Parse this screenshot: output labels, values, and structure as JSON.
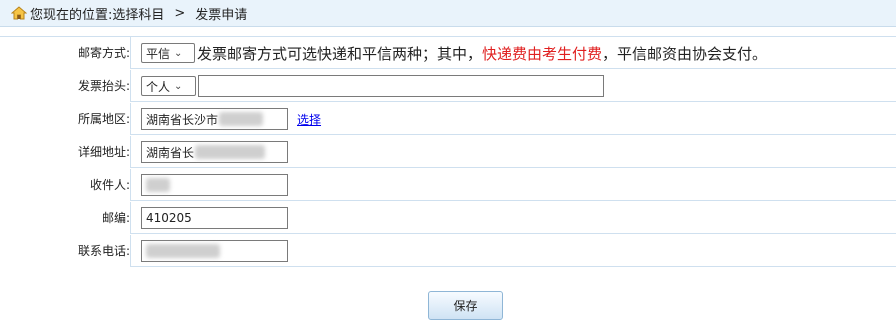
{
  "breadcrumb": {
    "prefix": "您现在的位置:选择科目",
    "separator": ">",
    "current": "发票申请"
  },
  "form": {
    "mail_method": {
      "label": "邮寄方式:",
      "selected": "平信",
      "note_before": "发票邮寄方式可选快递和平信两种；其中，",
      "note_highlight": "快递费由考生付费",
      "note_after": "，平信邮资由协会支付。"
    },
    "invoice_header": {
      "label": "发票抬头:",
      "selected": "个人",
      "value": ""
    },
    "region": {
      "label": "所属地区:",
      "value": "湖南省长沙市",
      "link": "选择"
    },
    "address": {
      "label": "详细地址:",
      "value": "湖南省长"
    },
    "recipient": {
      "label": "收件人:",
      "value": ""
    },
    "zip": {
      "label": "邮编:",
      "value": "410205"
    },
    "phone": {
      "label": "联系电话:",
      "value": ""
    }
  },
  "actions": {
    "save_label": "保存"
  },
  "colors": {
    "highlight": "#e02020",
    "link": "#0000ee",
    "breadcrumb_bg": "#e9f3fb",
    "border": "#cfe0ef"
  }
}
